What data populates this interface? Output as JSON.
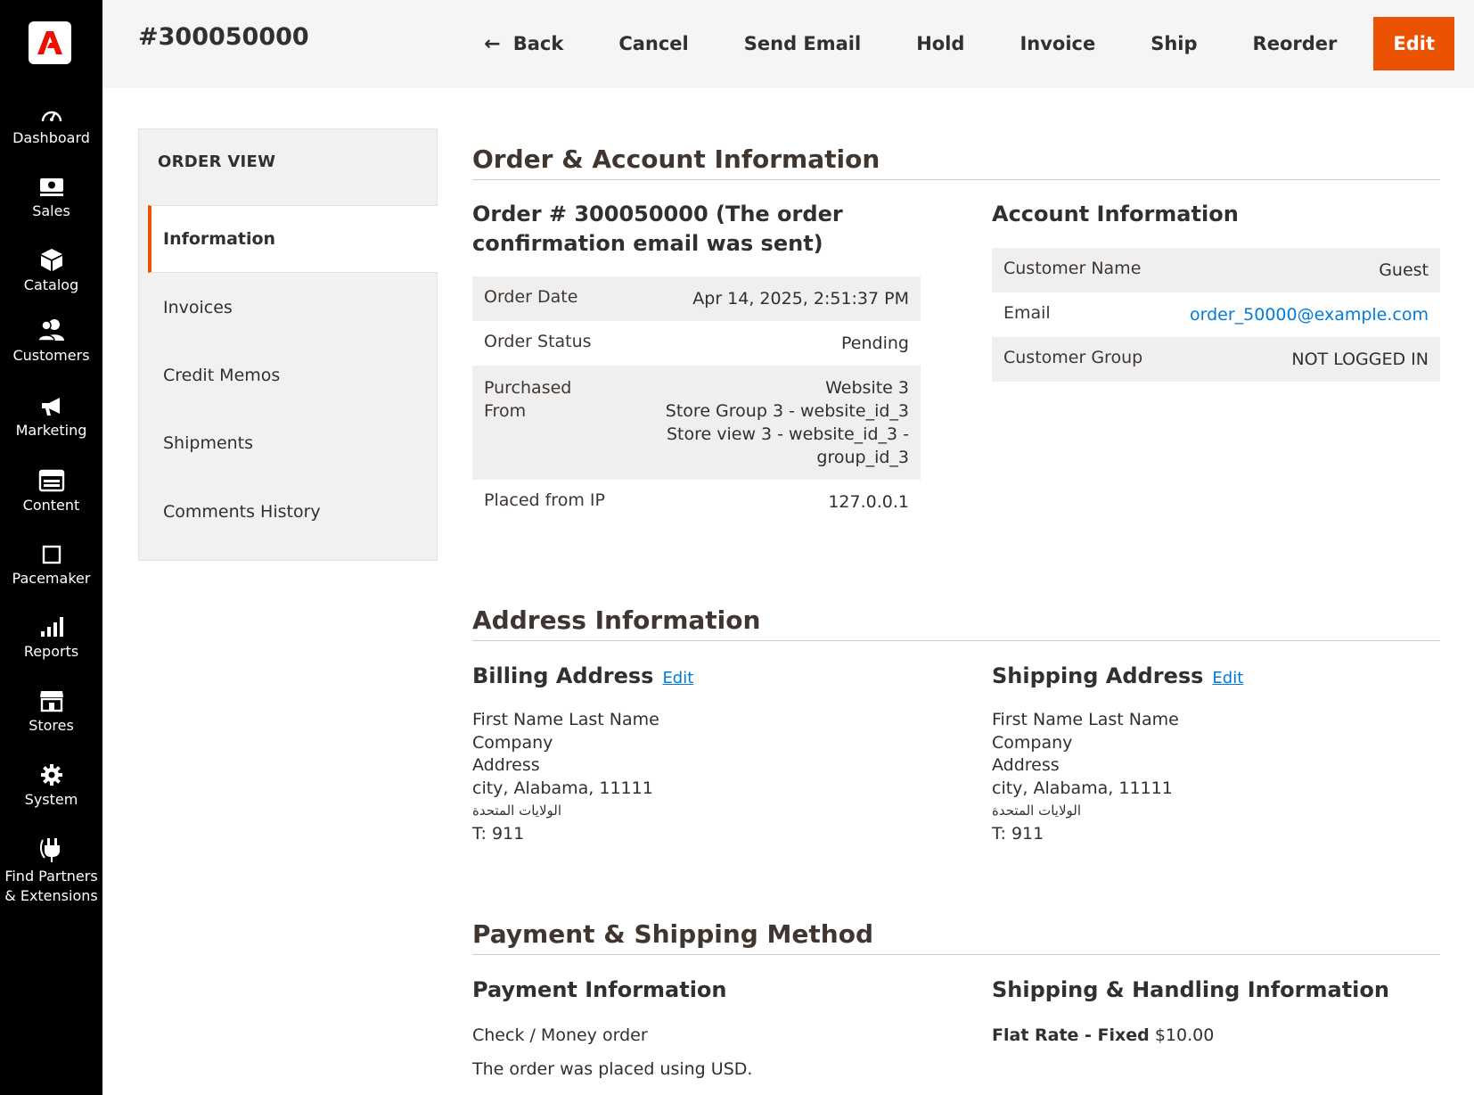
{
  "menu": {
    "items": [
      {
        "label": "Dashboard",
        "icon": "dashboard-icon"
      },
      {
        "label": "Sales",
        "icon": "sales-icon"
      },
      {
        "label": "Catalog",
        "icon": "catalog-icon"
      },
      {
        "label": "Customers",
        "icon": "customers-icon"
      },
      {
        "label": "Marketing",
        "icon": "marketing-icon"
      },
      {
        "label": "Content",
        "icon": "content-icon"
      },
      {
        "label": "Pacemaker",
        "icon": "pacemaker-icon"
      },
      {
        "label": "Reports",
        "icon": "reports-icon"
      },
      {
        "label": "Stores",
        "icon": "stores-icon"
      },
      {
        "label": "System",
        "icon": "gear-icon"
      },
      {
        "label_line1": "Find Partners",
        "label_line2": "& Extensions",
        "icon": "plug-icon"
      }
    ]
  },
  "header": {
    "title": "#300050000",
    "actions": {
      "back": "Back",
      "cancel": "Cancel",
      "send_email": "Send Email",
      "hold": "Hold",
      "invoice": "Invoice",
      "ship": "Ship",
      "reorder": "Reorder",
      "edit": "Edit"
    }
  },
  "tabs": {
    "title": "ORDER VIEW",
    "items": [
      "Information",
      "Invoices",
      "Credit Memos",
      "Shipments",
      "Comments History"
    ]
  },
  "order_account": {
    "section_title": "Order & Account Information",
    "order_title_line1": "Order # 300050000 (The order",
    "order_title_line2": "confirmation email was sent)",
    "order_rows": {
      "order_date_label": "Order Date",
      "order_date_value": "Apr 14, 2025, 2:51:37 PM",
      "order_status_label": "Order Status",
      "order_status_value": "Pending",
      "purchased_from_label_1": "Purchased",
      "purchased_from_label_2": "From",
      "purchased_from_line1": "Website 3",
      "purchased_from_line2": "Store Group 3 - website_id_3",
      "purchased_from_line3": "Store view 3 - website_id_3 -",
      "purchased_from_line4": "group_id_3",
      "placed_ip_label": "Placed from IP",
      "placed_ip_value": "127.0.0.1"
    },
    "account_title": "Account Information",
    "account_rows": {
      "customer_name_label": "Customer Name",
      "customer_name_value": "Guest",
      "email_label": "Email",
      "email_value": "order_50000@example.com",
      "customer_group_label": "Customer Group",
      "customer_group_value": "NOT LOGGED IN"
    }
  },
  "address": {
    "section_title": "Address Information",
    "billing_title": "Billing Address",
    "shipping_title": "Shipping Address",
    "edit_label": "Edit",
    "billing": {
      "name": "First Name Last Name",
      "company": "Company",
      "street": "Address",
      "city_line": "city, Alabama, 11111",
      "country": "الولايات المتحدة",
      "phone": "T: 911"
    },
    "shipping": {
      "name": "First Name Last Name",
      "company": "Company",
      "street": "Address",
      "city_line": "city, Alabama, 11111",
      "country": "الولايات المتحدة",
      "phone": "T: 911"
    }
  },
  "payment_shipping": {
    "section_title": "Payment & Shipping Method",
    "payment_title": "Payment Information",
    "payment_method": "Check / Money order",
    "currency_note": "The order was placed using USD.",
    "shipping_title": "Shipping & Handling Information",
    "shipping_method": "Flat Rate - Fixed",
    "shipping_price": "$10.00"
  },
  "colors": {
    "accent": "#eb5202",
    "link": "#007bdb",
    "menu_bg": "#000000"
  }
}
